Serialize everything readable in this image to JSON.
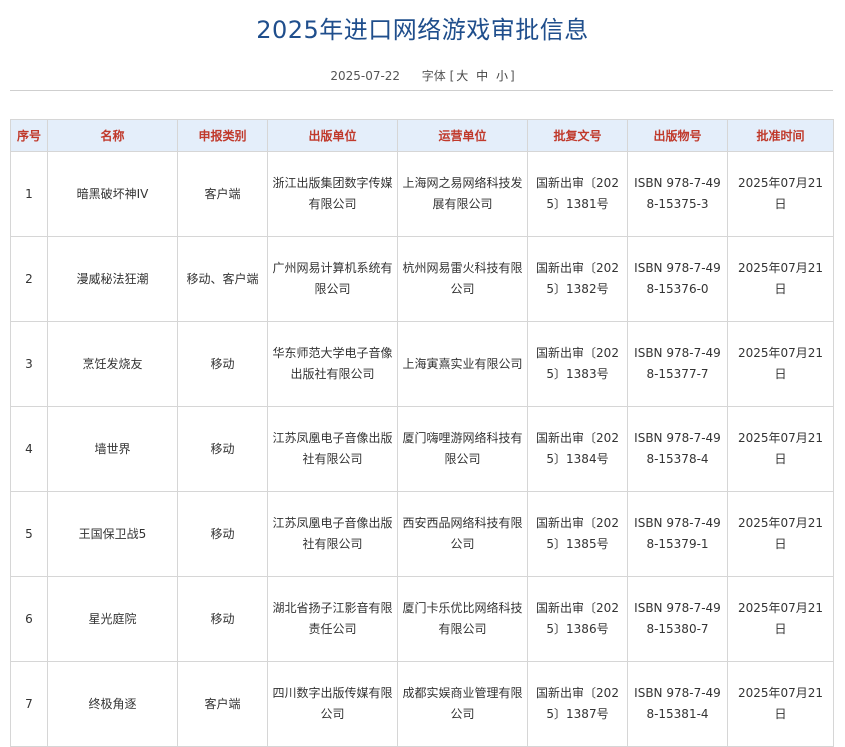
{
  "page": {
    "title": "2025年进口网络游戏审批信息",
    "date": "2025-07-22",
    "font_label": "字体",
    "font_open": "[",
    "font_large": "大",
    "font_medium": "中",
    "font_small": "小",
    "font_close": "]"
  },
  "table": {
    "headers": [
      "序号",
      "名称",
      "申报类别",
      "出版单位",
      "运营单位",
      "批复文号",
      "出版物号",
      "批准时间"
    ],
    "rows": [
      [
        "1",
        "暗黑破坏神IV",
        "客户端",
        "浙江出版集团数字传媒有限公司",
        "上海网之易网络科技发展有限公司",
        "国新出审〔2025〕1381号",
        "ISBN 978-7-498-15375-3",
        "2025年07月21日"
      ],
      [
        "2",
        "漫威秘法狂潮",
        "移动、客户端",
        "广州网易计算机系统有限公司",
        "杭州网易雷火科技有限公司",
        "国新出审〔2025〕1382号",
        "ISBN 978-7-498-15376-0",
        "2025年07月21日"
      ],
      [
        "3",
        "烹饪发烧友",
        "移动",
        "华东师范大学电子音像出版社有限公司",
        "上海寅熹实业有限公司",
        "国新出审〔2025〕1383号",
        "ISBN 978-7-498-15377-7",
        "2025年07月21日"
      ],
      [
        "4",
        "墙世界",
        "移动",
        "江苏凤凰电子音像出版社有限公司",
        "厦门嗨哩游网络科技有限公司",
        "国新出审〔2025〕1384号",
        "ISBN 978-7-498-15378-4",
        "2025年07月21日"
      ],
      [
        "5",
        "王国保卫战5",
        "移动",
        "江苏凤凰电子音像出版社有限公司",
        "西安西品网络科技有限公司",
        "国新出审〔2025〕1385号",
        "ISBN 978-7-498-15379-1",
        "2025年07月21日"
      ],
      [
        "6",
        "星光庭院",
        "移动",
        "湖北省扬子江影音有限责任公司",
        "厦门卡乐优比网络科技有限公司",
        "国新出审〔2025〕1386号",
        "ISBN 978-7-498-15380-7",
        "2025年07月21日"
      ],
      [
        "7",
        "终极角逐",
        "客户端",
        "四川数字出版传媒有限公司",
        "成都实娱商业管理有限公司",
        "国新出审〔2025〕1387号",
        "ISBN 978-7-498-15381-4",
        "2025年07月21日"
      ]
    ]
  }
}
